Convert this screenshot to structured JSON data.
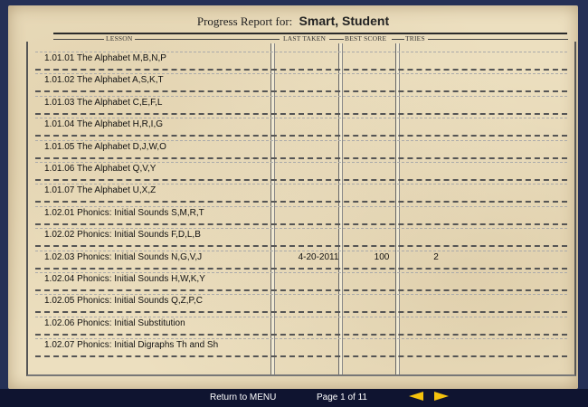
{
  "header": {
    "title_prefix": "Progress Report for:",
    "student_name": "Smart, Student"
  },
  "columns": {
    "lesson": "LESSON",
    "last_taken": "LAST TAKEN",
    "best_score": "BEST SCORE",
    "tries": "TRIES"
  },
  "rows": [
    {
      "lesson": "1.01.01   The Alphabet M,B,N,P",
      "last": "",
      "score": "",
      "tries": ""
    },
    {
      "lesson": "1.01.02   The Alphabet A,S,K,T",
      "last": "",
      "score": "",
      "tries": ""
    },
    {
      "lesson": "1.01.03   The Alphabet C,E,F,L",
      "last": "",
      "score": "",
      "tries": ""
    },
    {
      "lesson": "1.01.04   The Alphabet H,R,I,G",
      "last": "",
      "score": "",
      "tries": ""
    },
    {
      "lesson": "1.01.05   The Alphabet D,J,W,O",
      "last": "",
      "score": "",
      "tries": ""
    },
    {
      "lesson": "1.01.06   The Alphabet Q,V,Y",
      "last": "",
      "score": "",
      "tries": ""
    },
    {
      "lesson": "1.01.07   The Alphabet U,X,Z",
      "last": "",
      "score": "",
      "tries": ""
    },
    {
      "lesson": "1.02.01   Phonics: Initial Sounds S,M,R,T",
      "last": "",
      "score": "",
      "tries": ""
    },
    {
      "lesson": "1.02.02   Phonics: Initial Sounds F,D,L,B",
      "last": "",
      "score": "",
      "tries": ""
    },
    {
      "lesson": "1.02.03   Phonics: Initial Sounds N,G,V,J",
      "last": "4-20-2011",
      "score": "100",
      "tries": "2"
    },
    {
      "lesson": "1.02.04   Phonics: Initial Sounds H,W,K,Y",
      "last": "",
      "score": "",
      "tries": ""
    },
    {
      "lesson": "1.02.05   Phonics: Initial Sounds Q,Z,P,C",
      "last": "",
      "score": "",
      "tries": ""
    },
    {
      "lesson": "1.02.06   Phonics: Initial Substitution",
      "last": "",
      "score": "",
      "tries": ""
    },
    {
      "lesson": "1.02.07   Phonics: Initial Digraphs Th and Sh",
      "last": "",
      "score": "",
      "tries": ""
    }
  ],
  "footer": {
    "return_label": "Return to MENU",
    "page_label": "Page 1 of 11",
    "prev_icon": "arrow-left-icon",
    "next_icon": "arrow-right-icon",
    "arrow_color": "#f4c20d"
  }
}
